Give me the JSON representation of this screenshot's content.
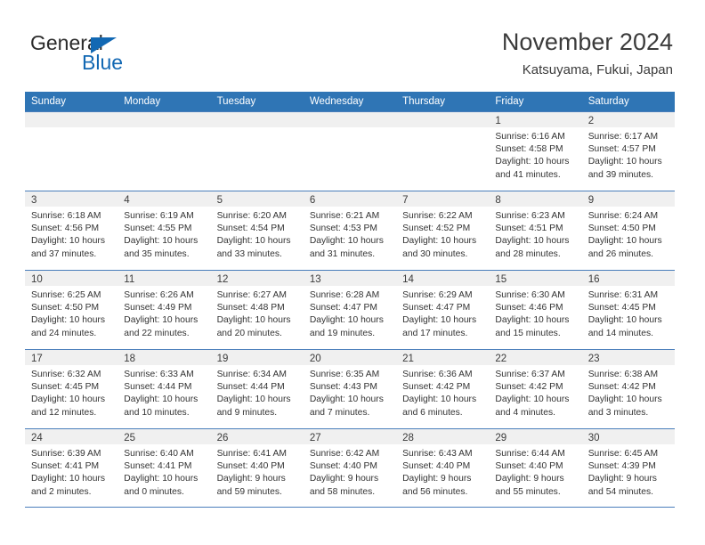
{
  "brand": {
    "name_part1": "General",
    "name_part2": "Blue",
    "triangle_icon": "triangle-icon",
    "colors": {
      "blue": "#1268b3",
      "dark": "#2b2b2b"
    }
  },
  "header": {
    "title": "November 2024",
    "subtitle": "Katsuyama, Fukui, Japan"
  },
  "calendar": {
    "accent_color": "#2f75b5",
    "daynum_band_color": "#f0f0f0",
    "weekdays": [
      "Sunday",
      "Monday",
      "Tuesday",
      "Wednesday",
      "Thursday",
      "Friday",
      "Saturday"
    ],
    "weeks": [
      [
        {
          "day": "",
          "sunrise": "",
          "sunset": "",
          "daylight_line1": "",
          "daylight_line2": "",
          "empty": true
        },
        {
          "day": "",
          "sunrise": "",
          "sunset": "",
          "daylight_line1": "",
          "daylight_line2": "",
          "empty": true
        },
        {
          "day": "",
          "sunrise": "",
          "sunset": "",
          "daylight_line1": "",
          "daylight_line2": "",
          "empty": true
        },
        {
          "day": "",
          "sunrise": "",
          "sunset": "",
          "daylight_line1": "",
          "daylight_line2": "",
          "empty": true
        },
        {
          "day": "",
          "sunrise": "",
          "sunset": "",
          "daylight_line1": "",
          "daylight_line2": "",
          "empty": true
        },
        {
          "day": "1",
          "sunrise": "Sunrise: 6:16 AM",
          "sunset": "Sunset: 4:58 PM",
          "daylight_line1": "Daylight: 10 hours",
          "daylight_line2": "and 41 minutes."
        },
        {
          "day": "2",
          "sunrise": "Sunrise: 6:17 AM",
          "sunset": "Sunset: 4:57 PM",
          "daylight_line1": "Daylight: 10 hours",
          "daylight_line2": "and 39 minutes."
        }
      ],
      [
        {
          "day": "3",
          "sunrise": "Sunrise: 6:18 AM",
          "sunset": "Sunset: 4:56 PM",
          "daylight_line1": "Daylight: 10 hours",
          "daylight_line2": "and 37 minutes."
        },
        {
          "day": "4",
          "sunrise": "Sunrise: 6:19 AM",
          "sunset": "Sunset: 4:55 PM",
          "daylight_line1": "Daylight: 10 hours",
          "daylight_line2": "and 35 minutes."
        },
        {
          "day": "5",
          "sunrise": "Sunrise: 6:20 AM",
          "sunset": "Sunset: 4:54 PM",
          "daylight_line1": "Daylight: 10 hours",
          "daylight_line2": "and 33 minutes."
        },
        {
          "day": "6",
          "sunrise": "Sunrise: 6:21 AM",
          "sunset": "Sunset: 4:53 PM",
          "daylight_line1": "Daylight: 10 hours",
          "daylight_line2": "and 31 minutes."
        },
        {
          "day": "7",
          "sunrise": "Sunrise: 6:22 AM",
          "sunset": "Sunset: 4:52 PM",
          "daylight_line1": "Daylight: 10 hours",
          "daylight_line2": "and 30 minutes."
        },
        {
          "day": "8",
          "sunrise": "Sunrise: 6:23 AM",
          "sunset": "Sunset: 4:51 PM",
          "daylight_line1": "Daylight: 10 hours",
          "daylight_line2": "and 28 minutes."
        },
        {
          "day": "9",
          "sunrise": "Sunrise: 6:24 AM",
          "sunset": "Sunset: 4:50 PM",
          "daylight_line1": "Daylight: 10 hours",
          "daylight_line2": "and 26 minutes."
        }
      ],
      [
        {
          "day": "10",
          "sunrise": "Sunrise: 6:25 AM",
          "sunset": "Sunset: 4:50 PM",
          "daylight_line1": "Daylight: 10 hours",
          "daylight_line2": "and 24 minutes."
        },
        {
          "day": "11",
          "sunrise": "Sunrise: 6:26 AM",
          "sunset": "Sunset: 4:49 PM",
          "daylight_line1": "Daylight: 10 hours",
          "daylight_line2": "and 22 minutes."
        },
        {
          "day": "12",
          "sunrise": "Sunrise: 6:27 AM",
          "sunset": "Sunset: 4:48 PM",
          "daylight_line1": "Daylight: 10 hours",
          "daylight_line2": "and 20 minutes."
        },
        {
          "day": "13",
          "sunrise": "Sunrise: 6:28 AM",
          "sunset": "Sunset: 4:47 PM",
          "daylight_line1": "Daylight: 10 hours",
          "daylight_line2": "and 19 minutes."
        },
        {
          "day": "14",
          "sunrise": "Sunrise: 6:29 AM",
          "sunset": "Sunset: 4:47 PM",
          "daylight_line1": "Daylight: 10 hours",
          "daylight_line2": "and 17 minutes."
        },
        {
          "day": "15",
          "sunrise": "Sunrise: 6:30 AM",
          "sunset": "Sunset: 4:46 PM",
          "daylight_line1": "Daylight: 10 hours",
          "daylight_line2": "and 15 minutes."
        },
        {
          "day": "16",
          "sunrise": "Sunrise: 6:31 AM",
          "sunset": "Sunset: 4:45 PM",
          "daylight_line1": "Daylight: 10 hours",
          "daylight_line2": "and 14 minutes."
        }
      ],
      [
        {
          "day": "17",
          "sunrise": "Sunrise: 6:32 AM",
          "sunset": "Sunset: 4:45 PM",
          "daylight_line1": "Daylight: 10 hours",
          "daylight_line2": "and 12 minutes."
        },
        {
          "day": "18",
          "sunrise": "Sunrise: 6:33 AM",
          "sunset": "Sunset: 4:44 PM",
          "daylight_line1": "Daylight: 10 hours",
          "daylight_line2": "and 10 minutes."
        },
        {
          "day": "19",
          "sunrise": "Sunrise: 6:34 AM",
          "sunset": "Sunset: 4:44 PM",
          "daylight_line1": "Daylight: 10 hours",
          "daylight_line2": "and 9 minutes."
        },
        {
          "day": "20",
          "sunrise": "Sunrise: 6:35 AM",
          "sunset": "Sunset: 4:43 PM",
          "daylight_line1": "Daylight: 10 hours",
          "daylight_line2": "and 7 minutes."
        },
        {
          "day": "21",
          "sunrise": "Sunrise: 6:36 AM",
          "sunset": "Sunset: 4:42 PM",
          "daylight_line1": "Daylight: 10 hours",
          "daylight_line2": "and 6 minutes."
        },
        {
          "day": "22",
          "sunrise": "Sunrise: 6:37 AM",
          "sunset": "Sunset: 4:42 PM",
          "daylight_line1": "Daylight: 10 hours",
          "daylight_line2": "and 4 minutes."
        },
        {
          "day": "23",
          "sunrise": "Sunrise: 6:38 AM",
          "sunset": "Sunset: 4:42 PM",
          "daylight_line1": "Daylight: 10 hours",
          "daylight_line2": "and 3 minutes."
        }
      ],
      [
        {
          "day": "24",
          "sunrise": "Sunrise: 6:39 AM",
          "sunset": "Sunset: 4:41 PM",
          "daylight_line1": "Daylight: 10 hours",
          "daylight_line2": "and 2 minutes."
        },
        {
          "day": "25",
          "sunrise": "Sunrise: 6:40 AM",
          "sunset": "Sunset: 4:41 PM",
          "daylight_line1": "Daylight: 10 hours",
          "daylight_line2": "and 0 minutes."
        },
        {
          "day": "26",
          "sunrise": "Sunrise: 6:41 AM",
          "sunset": "Sunset: 4:40 PM",
          "daylight_line1": "Daylight: 9 hours",
          "daylight_line2": "and 59 minutes."
        },
        {
          "day": "27",
          "sunrise": "Sunrise: 6:42 AM",
          "sunset": "Sunset: 4:40 PM",
          "daylight_line1": "Daylight: 9 hours",
          "daylight_line2": "and 58 minutes."
        },
        {
          "day": "28",
          "sunrise": "Sunrise: 6:43 AM",
          "sunset": "Sunset: 4:40 PM",
          "daylight_line1": "Daylight: 9 hours",
          "daylight_line2": "and 56 minutes."
        },
        {
          "day": "29",
          "sunrise": "Sunrise: 6:44 AM",
          "sunset": "Sunset: 4:40 PM",
          "daylight_line1": "Daylight: 9 hours",
          "daylight_line2": "and 55 minutes."
        },
        {
          "day": "30",
          "sunrise": "Sunrise: 6:45 AM",
          "sunset": "Sunset: 4:39 PM",
          "daylight_line1": "Daylight: 9 hours",
          "daylight_line2": "and 54 minutes."
        }
      ]
    ]
  }
}
